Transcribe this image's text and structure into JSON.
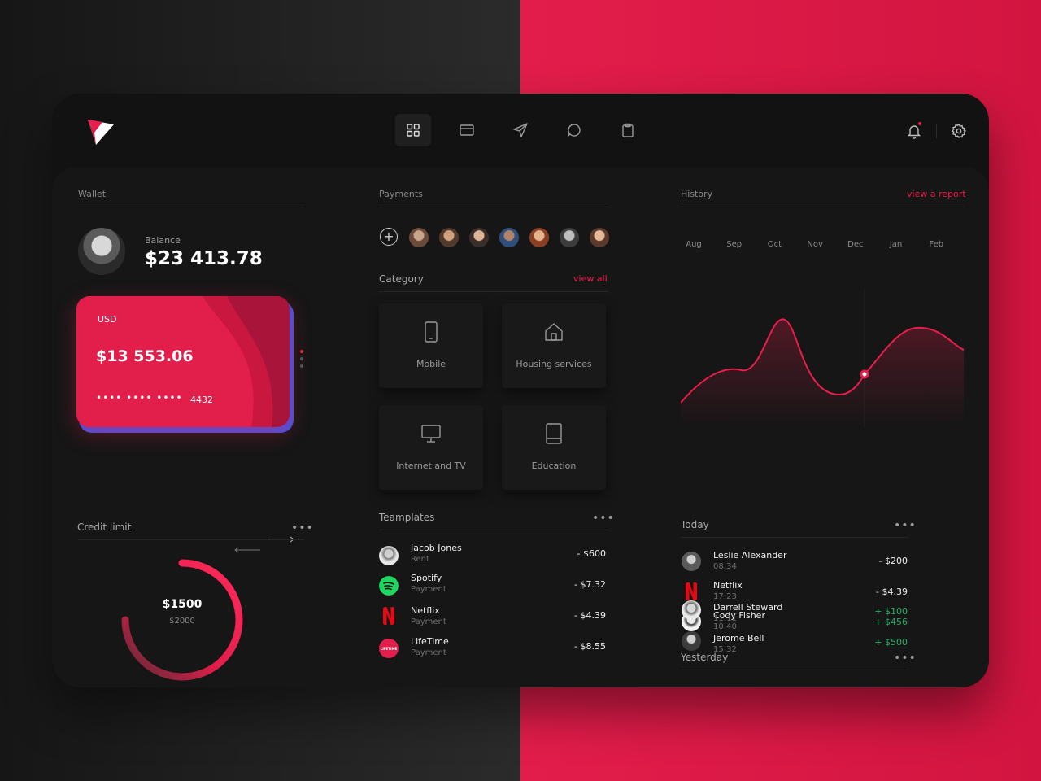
{
  "nav": {
    "items": [
      {
        "icon": "dashboard-grid-icon",
        "active": true
      },
      {
        "icon": "credit-card-icon",
        "active": false
      },
      {
        "icon": "send-icon",
        "active": false
      },
      {
        "icon": "chat-bubble-icon",
        "active": false
      },
      {
        "icon": "clipboard-icon",
        "active": false
      }
    ]
  },
  "wallet": {
    "title": "Wallet",
    "balance_label": "Balance",
    "balance_value": "$23 413.78",
    "card": {
      "currency": "USD",
      "amount": "$13 553.06",
      "masked": "•••• •••• ••••",
      "last4": "4432"
    }
  },
  "credit": {
    "title": "Credit limit",
    "used": "$1500",
    "limit": "$2000",
    "used_fraction": 0.75
  },
  "payments": {
    "title": "Payments",
    "payees_count": 7
  },
  "category": {
    "title": "Category",
    "view_all": "view all",
    "items": [
      {
        "label": "Mobile",
        "icon": "phone-icon"
      },
      {
        "label": "Housing services",
        "icon": "house-icon"
      },
      {
        "label": "Internet and TV",
        "icon": "monitor-icon"
      },
      {
        "label": "Education",
        "icon": "book-icon"
      }
    ]
  },
  "templates": {
    "title": "Teamplates",
    "rows": [
      {
        "name": "Jacob Jones",
        "sub": "Rent",
        "amount": "- $600"
      },
      {
        "name": "Spotify",
        "sub": "Payment",
        "amount": "- $7.32"
      },
      {
        "name": "Netflix",
        "sub": "Payment",
        "amount": "- $4.39"
      },
      {
        "name": "LifeTime",
        "sub": "Payment",
        "amount": "- $8.55",
        "logo_text": "LIFETIME"
      }
    ]
  },
  "history": {
    "title": "History",
    "report_link": "view a report",
    "months": [
      "Aug",
      "Sep",
      "Oct",
      "Nov",
      "Dec",
      "Jan",
      "Feb"
    ],
    "today_title": "Today",
    "today": [
      {
        "name": "Leslie Alexander",
        "time": "08:34",
        "amount": "- $200",
        "positive": false
      },
      {
        "name": "Netflix",
        "time": "17:23",
        "amount": "- $4.39",
        "positive": false
      },
      {
        "name": "Cody Fisher",
        "time": "10:40",
        "amount": "+ $456",
        "positive": true
      }
    ],
    "yesterday_title": "Yesterday",
    "yesterday": [
      {
        "name": "Darrell Steward",
        "time": "11:11",
        "amount": "+ $100",
        "positive": true
      },
      {
        "name": "Jerome Bell",
        "time": "15:32",
        "amount": "+ $500",
        "positive": true
      }
    ]
  },
  "chart_data": {
    "type": "line",
    "x": [
      "Aug",
      "Sep",
      "Oct",
      "Nov",
      "Dec",
      "Jan",
      "Feb"
    ],
    "highlight_index": 4,
    "colors": {
      "line": "#e91e4d",
      "accent": "#e91e4d",
      "positive": "#27ae6b"
    }
  }
}
